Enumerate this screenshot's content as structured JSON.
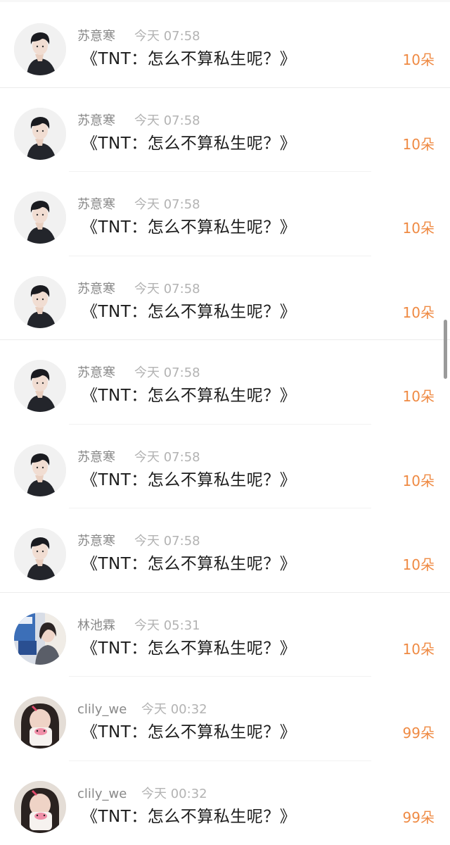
{
  "gift_list": {
    "accent_color": "#ef8a43",
    "items": [
      {
        "user": "苏意寒",
        "time": "今天 07:58",
        "message": "《TNT：怎么不算私生呢？》",
        "gift": "10朵",
        "avatar": "boy-black-hair-avatar"
      },
      {
        "user": "苏意寒",
        "time": "今天 07:58",
        "message": "《TNT：怎么不算私生呢？》",
        "gift": "10朵",
        "avatar": "boy-black-hair-avatar"
      },
      {
        "user": "苏意寒",
        "time": "今天 07:58",
        "message": "《TNT：怎么不算私生呢？》",
        "gift": "10朵",
        "avatar": "boy-black-hair-avatar"
      },
      {
        "user": "苏意寒",
        "time": "今天 07:58",
        "message": "《TNT：怎么不算私生呢？》",
        "gift": "10朵",
        "avatar": "boy-black-hair-avatar"
      },
      {
        "user": "苏意寒",
        "time": "今天 07:58",
        "message": "《TNT：怎么不算私生呢？》",
        "gift": "10朵",
        "avatar": "boy-black-hair-avatar"
      },
      {
        "user": "苏意寒",
        "time": "今天 07:58",
        "message": "《TNT：怎么不算私生呢？》",
        "gift": "10朵",
        "avatar": "boy-black-hair-avatar"
      },
      {
        "user": "苏意寒",
        "time": "今天 07:58",
        "message": "《TNT：怎么不算私生呢？》",
        "gift": "10朵",
        "avatar": "boy-black-hair-avatar"
      },
      {
        "user": "林池霖",
        "time": "今天 05:31",
        "message": "《TNT：怎么不算私生呢？》",
        "gift": "10朵",
        "avatar": "girl-room-photo-avatar"
      },
      {
        "user": "clily_we",
        "time": "今天 00:32",
        "message": "《TNT：怎么不算私生呢？》",
        "gift": "99朵",
        "avatar": "girl-pink-mug-avatar"
      },
      {
        "user": "clily_we",
        "time": "今天 00:32",
        "message": "《TNT：怎么不算私生呢？》",
        "gift": "99朵",
        "avatar": "girl-pink-mug-avatar"
      }
    ]
  }
}
